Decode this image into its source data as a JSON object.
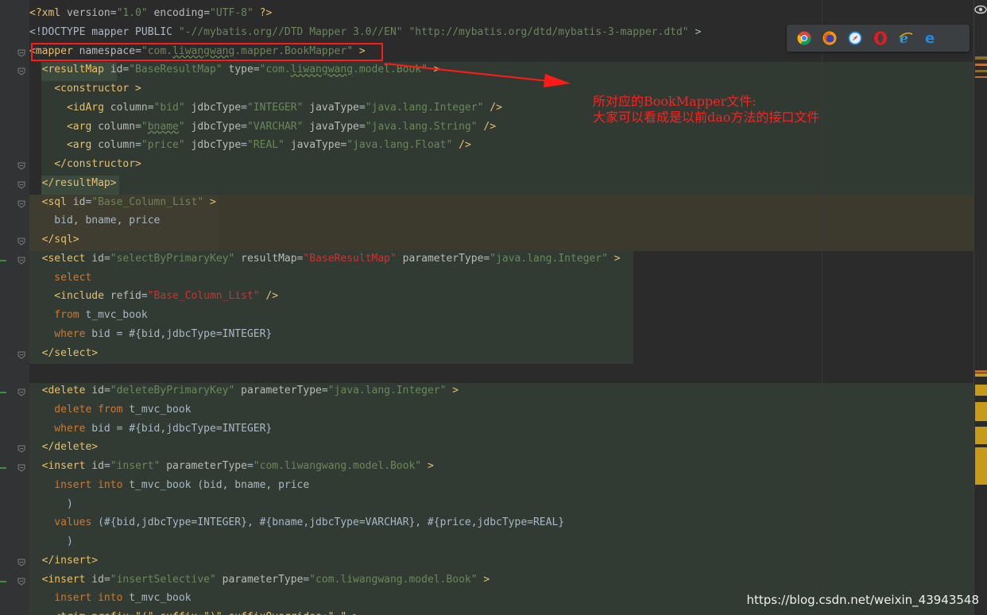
{
  "editor": {
    "lines": [
      {
        "tokens": [
          {
            "t": "<?xml ",
            "c": "t-pi"
          },
          {
            "t": "version",
            "c": "t-attr"
          },
          {
            "t": "=",
            "c": "t-plain"
          },
          {
            "t": "\"1.0\"",
            "c": "t-str"
          },
          {
            "t": " encoding",
            "c": "t-attr"
          },
          {
            "t": "=",
            "c": "t-plain"
          },
          {
            "t": "\"UTF-8\"",
            "c": "t-str"
          },
          {
            "t": " ?>",
            "c": "t-pi"
          }
        ]
      },
      {
        "tokens": [
          {
            "t": "<!DOCTYPE mapper PUBLIC ",
            "c": "t-plain"
          },
          {
            "t": "\"-//mybatis.org//DTD Mapper 3.0//EN\"",
            "c": "t-str"
          },
          {
            "t": " ",
            "c": "t-plain"
          },
          {
            "t": "\"http://mybatis.org/dtd/mybatis-3-mapper.dtd\"",
            "c": "t-str"
          },
          {
            "t": " >",
            "c": "t-plain"
          }
        ]
      },
      {
        "tokens": [
          {
            "t": "<",
            "c": "t-tag"
          },
          {
            "t": "mapper",
            "c": "t-tag"
          },
          {
            "t": " namespace",
            "c": "t-attr"
          },
          {
            "t": "=",
            "c": "t-plain"
          },
          {
            "t": "\"com.",
            "c": "t-str"
          },
          {
            "t": "liwangwang",
            "c": "t-str squig"
          },
          {
            "t": ".mapper.BookMapper\"",
            "c": "t-str"
          },
          {
            "t": " >",
            "c": "t-tag"
          }
        ]
      },
      {
        "tokens": [
          {
            "t": "  <resultMap",
            "c": "t-tag"
          },
          {
            "t": " id",
            "c": "t-attr"
          },
          {
            "t": "=",
            "c": "t-plain"
          },
          {
            "t": "\"BaseResultMap\"",
            "c": "t-str"
          },
          {
            "t": " type",
            "c": "t-attr"
          },
          {
            "t": "=",
            "c": "t-plain"
          },
          {
            "t": "\"com.",
            "c": "t-str"
          },
          {
            "t": "liwangwang",
            "c": "t-str squig"
          },
          {
            "t": ".model.Book\"",
            "c": "t-str"
          },
          {
            "t": " >",
            "c": "t-tag"
          }
        ]
      },
      {
        "tokens": [
          {
            "t": "    <constructor >",
            "c": "t-tag"
          }
        ]
      },
      {
        "tokens": [
          {
            "t": "      <idArg",
            "c": "t-tag"
          },
          {
            "t": " column",
            "c": "t-attr"
          },
          {
            "t": "=",
            "c": "t-plain"
          },
          {
            "t": "\"bid\"",
            "c": "t-str"
          },
          {
            "t": " jdbcType",
            "c": "t-attr"
          },
          {
            "t": "=",
            "c": "t-plain"
          },
          {
            "t": "\"INTEGER\"",
            "c": "t-str"
          },
          {
            "t": " javaType",
            "c": "t-attr"
          },
          {
            "t": "=",
            "c": "t-plain"
          },
          {
            "t": "\"java.lang.Integer\"",
            "c": "t-str"
          },
          {
            "t": " />",
            "c": "t-tag"
          }
        ]
      },
      {
        "tokens": [
          {
            "t": "      <arg",
            "c": "t-tag"
          },
          {
            "t": " column",
            "c": "t-attr"
          },
          {
            "t": "=",
            "c": "t-plain"
          },
          {
            "t": "\"",
            "c": "t-str"
          },
          {
            "t": "bname",
            "c": "t-str squig"
          },
          {
            "t": "\"",
            "c": "t-str"
          },
          {
            "t": " jdbcType",
            "c": "t-attr"
          },
          {
            "t": "=",
            "c": "t-plain"
          },
          {
            "t": "\"VARCHAR\"",
            "c": "t-str"
          },
          {
            "t": " javaType",
            "c": "t-attr"
          },
          {
            "t": "=",
            "c": "t-plain"
          },
          {
            "t": "\"java.lang.String\"",
            "c": "t-str"
          },
          {
            "t": " />",
            "c": "t-tag"
          }
        ]
      },
      {
        "tokens": [
          {
            "t": "      <arg",
            "c": "t-tag"
          },
          {
            "t": " column",
            "c": "t-attr"
          },
          {
            "t": "=",
            "c": "t-plain"
          },
          {
            "t": "\"price\"",
            "c": "t-str"
          },
          {
            "t": " jdbcType",
            "c": "t-attr"
          },
          {
            "t": "=",
            "c": "t-plain"
          },
          {
            "t": "\"REAL\"",
            "c": "t-str"
          },
          {
            "t": " javaType",
            "c": "t-attr"
          },
          {
            "t": "=",
            "c": "t-plain"
          },
          {
            "t": "\"java.lang.Float\"",
            "c": "t-str"
          },
          {
            "t": " />",
            "c": "t-tag"
          }
        ]
      },
      {
        "tokens": [
          {
            "t": "    </constructor>",
            "c": "t-tag"
          }
        ]
      },
      {
        "tokens": [
          {
            "t": "  </resultMap>",
            "c": "t-tag"
          }
        ]
      },
      {
        "tokens": [
          {
            "t": "  <sql",
            "c": "t-tag"
          },
          {
            "t": " id",
            "c": "t-attr"
          },
          {
            "t": "=",
            "c": "t-plain"
          },
          {
            "t": "\"Base_Column_List\"",
            "c": "t-str"
          },
          {
            "t": " >",
            "c": "t-tag"
          }
        ]
      },
      {
        "tokens": [
          {
            "t": "    bid, bname, price",
            "c": "t-plain"
          }
        ]
      },
      {
        "tokens": [
          {
            "t": "  </sql>",
            "c": "t-tag"
          }
        ]
      },
      {
        "tokens": [
          {
            "t": "  <select",
            "c": "t-tag"
          },
          {
            "t": " id",
            "c": "t-attr"
          },
          {
            "t": "=",
            "c": "t-plain"
          },
          {
            "t": "\"selectByPrimaryKey\"",
            "c": "t-str"
          },
          {
            "t": " resultMap",
            "c": "t-attr"
          },
          {
            "t": "=",
            "c": "t-plain"
          },
          {
            "t": "\"BaseResultMap\"",
            "c": "t-red"
          },
          {
            "t": " parameterType",
            "c": "t-attr"
          },
          {
            "t": "=",
            "c": "t-plain"
          },
          {
            "t": "\"java.lang.Integer\"",
            "c": "t-str"
          },
          {
            "t": " >",
            "c": "t-tag"
          }
        ]
      },
      {
        "tokens": [
          {
            "t": "    select",
            "c": "t-sql"
          }
        ]
      },
      {
        "tokens": [
          {
            "t": "    <include",
            "c": "t-tag"
          },
          {
            "t": " refid",
            "c": "t-attr"
          },
          {
            "t": "=",
            "c": "t-plain"
          },
          {
            "t": "\"Base_Column_List\"",
            "c": "t-red"
          },
          {
            "t": " />",
            "c": "t-tag"
          }
        ]
      },
      {
        "tokens": [
          {
            "t": "    from",
            "c": "t-sql"
          },
          {
            "t": " t_mvc_book",
            "c": "t-plain"
          }
        ]
      },
      {
        "tokens": [
          {
            "t": "    where",
            "c": "t-sql"
          },
          {
            "t": " bid = #{bid,jdbcType=INTEGER}",
            "c": "t-plain"
          }
        ]
      },
      {
        "tokens": [
          {
            "t": "  </select>",
            "c": "t-tag"
          }
        ]
      },
      {
        "tokens": []
      },
      {
        "tokens": [
          {
            "t": "  <delete",
            "c": "t-tag"
          },
          {
            "t": " id",
            "c": "t-attr"
          },
          {
            "t": "=",
            "c": "t-plain"
          },
          {
            "t": "\"deleteByPrimaryKey\"",
            "c": "t-str"
          },
          {
            "t": " parameterType",
            "c": "t-attr"
          },
          {
            "t": "=",
            "c": "t-plain"
          },
          {
            "t": "\"java.lang.Integer\"",
            "c": "t-str"
          },
          {
            "t": " >",
            "c": "t-tag"
          }
        ]
      },
      {
        "tokens": [
          {
            "t": "    delete from",
            "c": "t-sql"
          },
          {
            "t": " t_mvc_book",
            "c": "t-plain"
          }
        ]
      },
      {
        "tokens": [
          {
            "t": "    where",
            "c": "t-sql"
          },
          {
            "t": " bid = #{bid,jdbcType=INTEGER}",
            "c": "t-plain"
          }
        ]
      },
      {
        "tokens": [
          {
            "t": "  </delete>",
            "c": "t-tag"
          }
        ]
      },
      {
        "tokens": [
          {
            "t": "  <insert",
            "c": "t-tag"
          },
          {
            "t": " id",
            "c": "t-attr"
          },
          {
            "t": "=",
            "c": "t-plain"
          },
          {
            "t": "\"insert\"",
            "c": "t-str"
          },
          {
            "t": " parameterType",
            "c": "t-attr"
          },
          {
            "t": "=",
            "c": "t-plain"
          },
          {
            "t": "\"com.liwangwang.model.Book\"",
            "c": "t-str"
          },
          {
            "t": " >",
            "c": "t-tag"
          }
        ]
      },
      {
        "tokens": [
          {
            "t": "    insert into",
            "c": "t-sql"
          },
          {
            "t": " t_mvc_book (bid, bname, price",
            "c": "t-plain"
          }
        ]
      },
      {
        "tokens": [
          {
            "t": "      )",
            "c": "t-plain"
          }
        ]
      },
      {
        "tokens": [
          {
            "t": "    values",
            "c": "t-sql"
          },
          {
            "t": " (#{bid,jdbcType=INTEGER}, #{bname,jdbcType=VARCHAR}, #{price,jdbcType=REAL}",
            "c": "t-plain"
          }
        ]
      },
      {
        "tokens": [
          {
            "t": "      )",
            "c": "t-plain"
          }
        ]
      },
      {
        "tokens": [
          {
            "t": "  </insert>",
            "c": "t-tag"
          }
        ]
      },
      {
        "tokens": [
          {
            "t": "  <insert",
            "c": "t-tag"
          },
          {
            "t": " id",
            "c": "t-attr"
          },
          {
            "t": "=",
            "c": "t-plain"
          },
          {
            "t": "\"insertSelective\"",
            "c": "t-str"
          },
          {
            "t": " parameterType",
            "c": "t-attr"
          },
          {
            "t": "=",
            "c": "t-plain"
          },
          {
            "t": "\"com.liwangwang.model.Book\"",
            "c": "t-str"
          },
          {
            "t": " >",
            "c": "t-tag"
          }
        ]
      },
      {
        "tokens": [
          {
            "t": "    insert into",
            "c": "t-sql"
          },
          {
            "t": " t_mvc_book",
            "c": "t-plain"
          }
        ]
      },
      {
        "tokens": [
          {
            "t": "    <trim prefix=\"(\" suffix=\")\" suffixOverrides=\",\" >",
            "c": "t-tag"
          }
        ]
      }
    ]
  },
  "annotation": {
    "line1": "所对应的BookMapper文件:",
    "line2": "大家可以看成是以前dao方法的接口文件"
  },
  "browser_icons": [
    "chrome-icon",
    "firefox-icon",
    "safari-icon",
    "opera-icon",
    "ie-icon",
    "edge-icon"
  ],
  "watermark": "https://blog.csdn.net/weixin_43943548",
  "colors": {
    "background": "#2b2b2b",
    "tag": "#e8bf6a",
    "string": "#6a8759",
    "keyword": "#cc7832",
    "annotation": "#ff2020"
  }
}
